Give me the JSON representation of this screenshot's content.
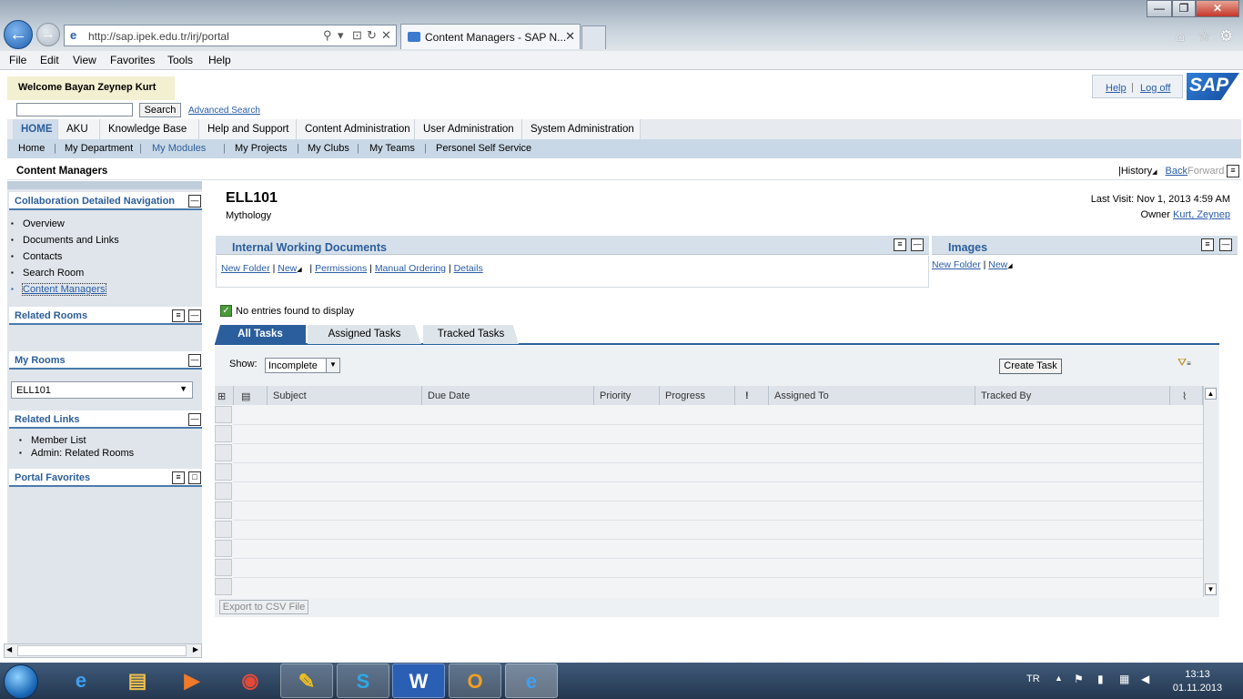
{
  "browser": {
    "url": "http://sap.ipek.edu.tr/irj/portal",
    "tab_title": "Content Managers - SAP N...",
    "menu": [
      "File",
      "Edit",
      "View",
      "Favorites",
      "Tools",
      "Help"
    ]
  },
  "portal": {
    "welcome": "Welcome Bayan Zeynep Kurt",
    "help_link": "Help",
    "logoff_link": "Log off",
    "logo_text": "SAP",
    "search_button": "Search",
    "advanced_search": "Advanced Search",
    "top_nav": [
      "HOME",
      "AKU",
      "Knowledge Base",
      "Help and Support",
      "Content Administration",
      "User Administration",
      "System Administration"
    ],
    "sub_nav": [
      "Home",
      "My Department",
      "My Modules",
      "My Projects",
      "My Clubs",
      "My Teams",
      "Personel Self Service"
    ],
    "page_title": "Content Managers",
    "history": "History",
    "back": "Back",
    "forward": "Forward"
  },
  "left_nav": {
    "collab_title": "Collaboration Detailed Navigation",
    "collab_items": [
      "Overview",
      "Documents and Links",
      "Contacts",
      "Search Room",
      "Content Managers"
    ],
    "related_rooms": "Related Rooms",
    "my_rooms": "My Rooms",
    "room_selected": "ELL101",
    "related_links": "Related Links",
    "related_links_items": [
      "Member List",
      "Admin: Related Rooms"
    ],
    "portal_favorites": "Portal Favorites"
  },
  "room": {
    "title": "ELL101",
    "subtitle": "Mythology",
    "last_visit": "Last Visit: Nov 1, 2013 4:59 AM",
    "owner_label": "Owner",
    "owner_name": "Kurt, Zeynep"
  },
  "iwd": {
    "title": "Internal Working Documents",
    "links": [
      "New Folder",
      "New",
      "Permissions",
      "Manual Ordering",
      "Details"
    ]
  },
  "images": {
    "title": "Images",
    "links": [
      "New Folder",
      "New"
    ]
  },
  "no_entries": "No entries found to display",
  "tasks": {
    "tabs": [
      "All Tasks",
      "Assigned Tasks",
      "Tracked Tasks"
    ],
    "show_label": "Show:",
    "show_value": "Incomplete",
    "create_button": "Create Task",
    "columns": [
      "Subject",
      "Due Date",
      "Priority",
      "Progress",
      "!",
      "Assigned To",
      "Tracked By"
    ],
    "export_button": "Export to CSV File"
  },
  "taskbar": {
    "lang": "TR",
    "time": "13:13",
    "date": "01.11.2013"
  },
  "colors": {
    "accent": "#2b5e9c",
    "nav_bg": "#c9d8e6",
    "left_bg": "#dfe5eb"
  }
}
